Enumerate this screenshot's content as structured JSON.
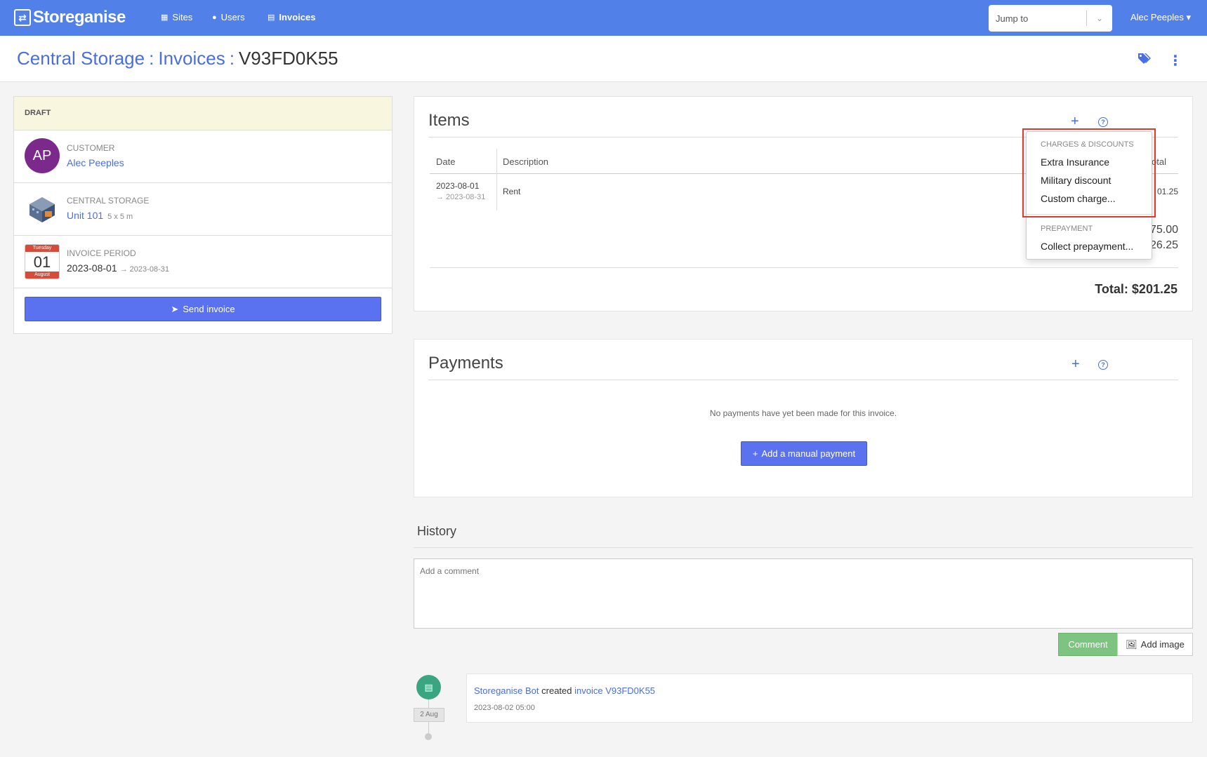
{
  "nav": {
    "brand": "Storeganise",
    "links": [
      "Sites",
      "Users",
      "Invoices"
    ],
    "jump_to_placeholder": "Jump to",
    "user": "Alec Peeples"
  },
  "header": {
    "crumb1": "Central Storage",
    "crumb2": "Invoices",
    "current": "V93FD0K55",
    "sep": ":"
  },
  "invoice_summary": {
    "status": "DRAFT",
    "avatar_initials": "AP",
    "customer_label": "CUSTOMER",
    "customer_name": "Alec Peeples",
    "site_label": "CENTRAL STORAGE",
    "unit_name": "Unit 101",
    "unit_size": "5 x 5 m",
    "period_label": "INVOICE PERIOD",
    "period_start": "2023-08-01",
    "period_end": "→ 2023-08-31",
    "calendar_weekday": "Tuesday",
    "calendar_day": "01",
    "calendar_month": "August",
    "send_button": "Send invoice"
  },
  "items": {
    "title": "Items",
    "columns": [
      "Date",
      "Description",
      "Total"
    ],
    "col_total_partial": "otal",
    "row": {
      "date": "2023-08-01",
      "date_end": "→ 2023-08-31",
      "description": "Rent",
      "total_partial": "01.25"
    },
    "subtotal_partial": "75.00",
    "tax_partial": "26.25",
    "total": "Total: $201.25"
  },
  "add_item_menu": {
    "group1_header": "CHARGES & DISCOUNTS",
    "group1_items": [
      "Extra Insurance",
      "Military discount",
      "Custom charge..."
    ],
    "group2_header": "PREPAYMENT",
    "group2_items": [
      "Collect prepayment..."
    ]
  },
  "payments": {
    "title": "Payments",
    "empty_text": "No payments have yet been made for this invoice.",
    "add_button": "Add a manual payment"
  },
  "history": {
    "title": "History",
    "comment_placeholder": "Add a comment",
    "comment_button": "Comment",
    "image_button": "Add image",
    "entry": {
      "actor": "Storeganise Bot",
      "verb": "created",
      "object": "invoice V93FD0K55",
      "timestamp": "2023-08-02 05:00",
      "date_badge": "2 Aug"
    }
  },
  "colors": {
    "navbar": "#5280e9",
    "primary_button": "#5a72f0",
    "link": "#4a6ee0",
    "draft_bg": "#f8f6df",
    "avatar": "#7b2a8c",
    "comment_button": "#7cc47f",
    "timeline_dot": "#3aa581",
    "highlight": "#e03a2a"
  }
}
